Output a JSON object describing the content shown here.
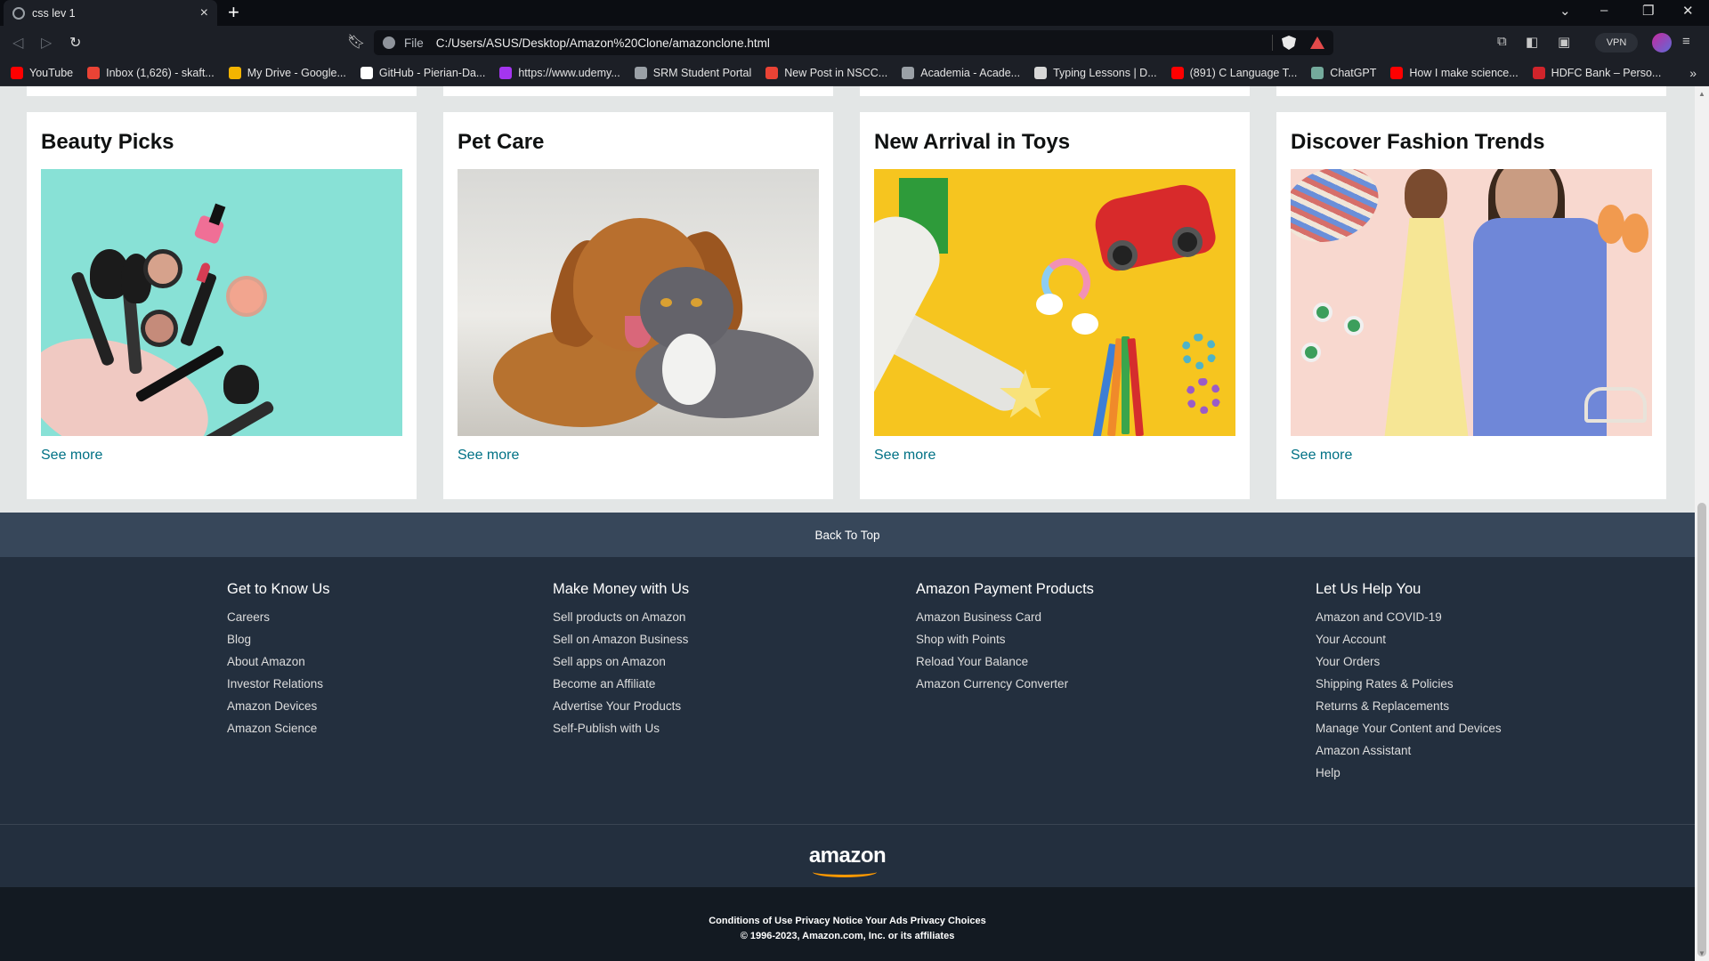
{
  "browser": {
    "tab_title": "css lev 1",
    "url_scheme": "File",
    "url": "C:/Users/ASUS/Desktop/Amazon%20Clone/amazonclone.html",
    "vpn_label": "VPN",
    "bookmarks": [
      {
        "label": "YouTube",
        "icon": "youtube-icon",
        "color": "#ff0000"
      },
      {
        "label": "Inbox (1,626) - skaft...",
        "icon": "gmail-icon",
        "color": "#ea4335"
      },
      {
        "label": "My Drive - Google...",
        "icon": "drive-icon",
        "color": "#f4b400"
      },
      {
        "label": "GitHub - Pierian-Da...",
        "icon": "github-icon",
        "color": "#ffffff"
      },
      {
        "label": "https://www.udemy...",
        "icon": "udemy-icon",
        "color": "#a435f0"
      },
      {
        "label": "SRM Student Portal",
        "icon": "globe-icon",
        "color": "#9aa0a6"
      },
      {
        "label": "New Post in NSCC...",
        "icon": "gmail-icon",
        "color": "#ea4335"
      },
      {
        "label": "Academia - Acade...",
        "icon": "globe-icon",
        "color": "#9aa0a6"
      },
      {
        "label": "Typing Lessons | D...",
        "icon": "typing-icon",
        "color": "#d7d7d7"
      },
      {
        "label": "(891) C Language T...",
        "icon": "youtube-icon",
        "color": "#ff0000"
      },
      {
        "label": "ChatGPT",
        "icon": "chatgpt-icon",
        "color": "#74aa9c"
      },
      {
        "label": "How I make science...",
        "icon": "youtube-icon",
        "color": "#ff0000"
      },
      {
        "label": "HDFC Bank – Perso...",
        "icon": "hdfc-icon",
        "color": "#d0242b"
      }
    ]
  },
  "cards": [
    {
      "title": "Beauty Picks",
      "link": "See more"
    },
    {
      "title": "Pet Care",
      "link": "See more"
    },
    {
      "title": "New Arrival in Toys",
      "link": "See more"
    },
    {
      "title": "Discover Fashion Trends",
      "link": "See more"
    }
  ],
  "footer": {
    "back_to_top": "Back To Top",
    "columns": [
      {
        "heading": "Get to Know Us",
        "links": [
          "Careers",
          "Blog",
          "About Amazon",
          "Investor Relations",
          "Amazon Devices",
          "Amazon Science"
        ]
      },
      {
        "heading": "Make Money with Us",
        "links": [
          "Sell products on Amazon",
          "Sell on Amazon Business",
          "Sell apps on Amazon",
          "Become an Affiliate",
          "Advertise Your Products",
          "Self-Publish with Us"
        ]
      },
      {
        "heading": "Amazon Payment Products",
        "links": [
          "Amazon Business Card",
          "Shop with Points",
          "Reload Your Balance",
          "Amazon Currency Converter"
        ]
      },
      {
        "heading": "Let Us Help You",
        "links": [
          "Amazon and COVID-19",
          "Your Account",
          "Your Orders",
          "Shipping Rates & Policies",
          "Returns & Replacements",
          "Manage Your Content and Devices",
          "Amazon Assistant",
          "Help"
        ]
      }
    ],
    "logo_text": "amazon",
    "legal_links": "Conditions of Use Privacy Notice Your Ads Privacy Choices",
    "copyright": "© 1996-2023, Amazon.com, Inc. or its affiliates"
  },
  "colors": {
    "link": "#007185",
    "footer_bg": "#232f3e",
    "back_to_top_bg": "#37475a",
    "bottom_bg": "#131a22",
    "page_bg": "#e3e6e6"
  }
}
